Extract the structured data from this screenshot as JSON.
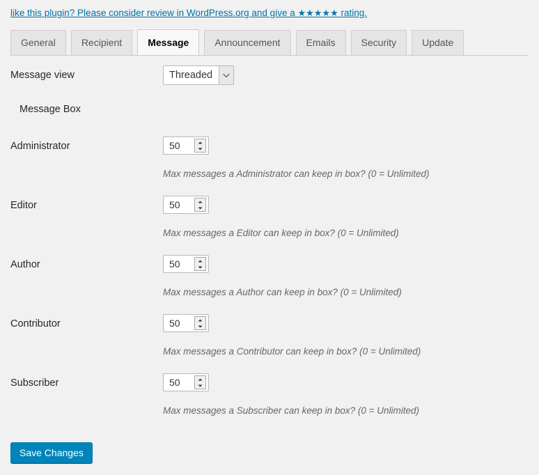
{
  "promo": {
    "text_before": "like this plugin? Please consider review in WordPress.org and give a ",
    "stars": "★★★★★",
    "text_after": " rating.",
    "link_color": "#0073aa"
  },
  "tabs": [
    {
      "label": "General",
      "active": false
    },
    {
      "label": "Recipient",
      "active": false
    },
    {
      "label": "Message",
      "active": true
    },
    {
      "label": "Announcement",
      "active": false
    },
    {
      "label": "Emails",
      "active": false
    },
    {
      "label": "Security",
      "active": false
    },
    {
      "label": "Update",
      "active": false
    }
  ],
  "form": {
    "message_view": {
      "label": "Message view",
      "value": "Threaded",
      "options": [
        "Threaded"
      ]
    },
    "section_title": "Message Box",
    "roles": [
      {
        "label": "Administrator",
        "value": "50",
        "help": "Max messages a Administrator can keep in box? (0 = Unlimited)"
      },
      {
        "label": "Editor",
        "value": "50",
        "help": "Max messages a Editor can keep in box? (0 = Unlimited)"
      },
      {
        "label": "Author",
        "value": "50",
        "help": "Max messages a Author can keep in box? (0 = Unlimited)"
      },
      {
        "label": "Contributor",
        "value": "50",
        "help": "Max messages a Contributor can keep in box? (0 = Unlimited)"
      },
      {
        "label": "Subscriber",
        "value": "50",
        "help": "Max messages a Subscriber can keep in box? (0 = Unlimited)"
      }
    ]
  },
  "submit": {
    "save_label": "Save Changes",
    "button_color": "#0085ba"
  }
}
